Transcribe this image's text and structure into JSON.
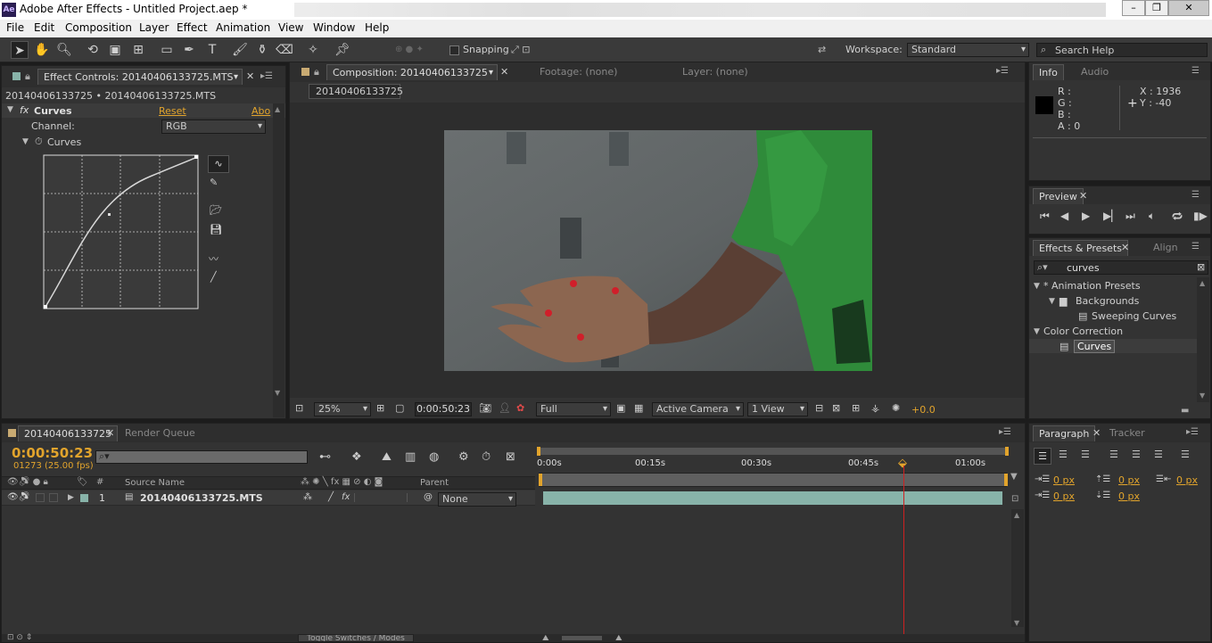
{
  "window": {
    "title": "Adobe After Effects - Untitled Project.aep *",
    "app_badge": "Ae"
  },
  "menu": [
    "File",
    "Edit",
    "Composition",
    "Layer",
    "Effect",
    "Animation",
    "View",
    "Window",
    "Help"
  ],
  "toolbar": {
    "snapping_label": "Snapping",
    "workspace_label": "Workspace:",
    "workspace_value": "Standard",
    "search_placeholder": "Search Help"
  },
  "effect_controls": {
    "tab": "Effect Controls: 20140406133725.MTS",
    "breadcrumb": "20140406133725 • 20140406133725.MTS",
    "effect_name": "Curves",
    "reset": "Reset",
    "about": "Abo",
    "channel_label": "Channel:",
    "channel_value": "RGB",
    "curves_label": "Curves"
  },
  "composition": {
    "tab": "Composition: 20140406133725",
    "footage_tab": "Footage: (none)",
    "layer_tab": "Layer: (none)",
    "comp_name_tab": "20140406133725",
    "zoom": "25%",
    "timecode": "0:00:50:23",
    "resolution": "Full",
    "camera": "Active Camera",
    "view": "1 View",
    "exposure": "+0.0"
  },
  "info": {
    "tab": "Info",
    "audio_tab": "Audio",
    "r": "R :",
    "g": "G :",
    "b": "B :",
    "a": "A : 0",
    "x": "X : 1936",
    "y": "Y : -40"
  },
  "preview": {
    "tab": "Preview"
  },
  "effects_presets": {
    "tab": "Effects & Presets",
    "align_tab": "Align",
    "search_value": "curves",
    "tree": [
      {
        "label": "* Animation Presets"
      },
      {
        "label": "Backgrounds"
      },
      {
        "label": "Sweeping Curves"
      },
      {
        "label": "Color Correction"
      },
      {
        "label": "Curves"
      }
    ]
  },
  "timeline": {
    "tab": "20140406133725",
    "render_tab": "Render Queue",
    "timecode": "0:00:50:23",
    "frames": "01273 (25.00 fps)",
    "col_hash": "#",
    "col_source": "Source Name",
    "col_parent": "Parent",
    "ruler": [
      "0:00s",
      "00:15s",
      "00:30s",
      "00:45s",
      "01:00s"
    ],
    "layer": {
      "index": "1",
      "name": "20140406133725.MTS",
      "parent": "None"
    },
    "toggle_label": "Toggle Switches / Modes"
  },
  "paragraph": {
    "tab": "Paragraph",
    "tracker_tab": "Tracker",
    "px1": "0 px",
    "px2": "0 px",
    "px3": "0 px",
    "px4": "0 px",
    "px5": "0 px"
  },
  "colors": {
    "accent": "#e2a42c",
    "layer_bar": "#88b3a9",
    "playhead": "#d02020"
  }
}
